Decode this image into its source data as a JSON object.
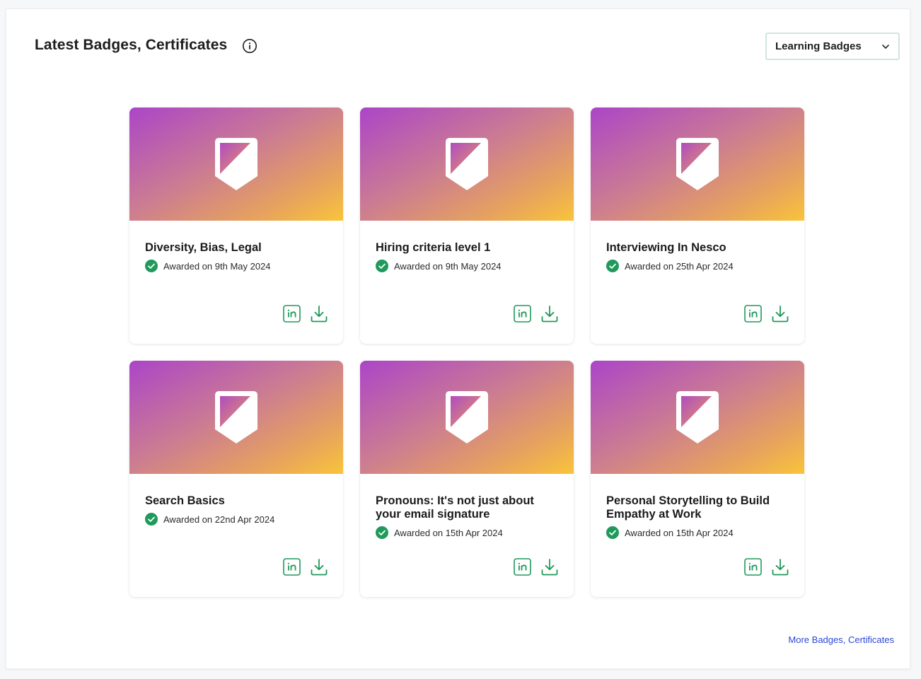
{
  "header": {
    "title": "Latest Badges, Certificates",
    "info_icon": "info-icon"
  },
  "filter": {
    "selected": "Learning Badges",
    "icon": "chevron-down-icon"
  },
  "cards": [
    {
      "title": "Diversity, Bias, Legal",
      "awarded": "Awarded on 9th May 2024"
    },
    {
      "title": "Hiring criteria level 1",
      "awarded": "Awarded on 9th May 2024"
    },
    {
      "title": "Interviewing In Nesco",
      "awarded": "Awarded on 25th Apr 2024"
    },
    {
      "title": "Search Basics",
      "awarded": "Awarded on 22nd Apr 2024"
    },
    {
      "title": "Pronouns: It's not just about your email signature",
      "awarded": "Awarded on 15th Apr 2024"
    },
    {
      "title": "Personal Storytelling to Build Empathy at Work",
      "awarded": "Awarded on 15th Apr 2024"
    }
  ],
  "footer": {
    "more_link": "More Badges, Certificates"
  },
  "colors": {
    "accent_green": "#1f9a5a",
    "link_blue": "#2a47d6",
    "gradient_start": "#ab45c8",
    "gradient_end": "#f9c43a"
  }
}
